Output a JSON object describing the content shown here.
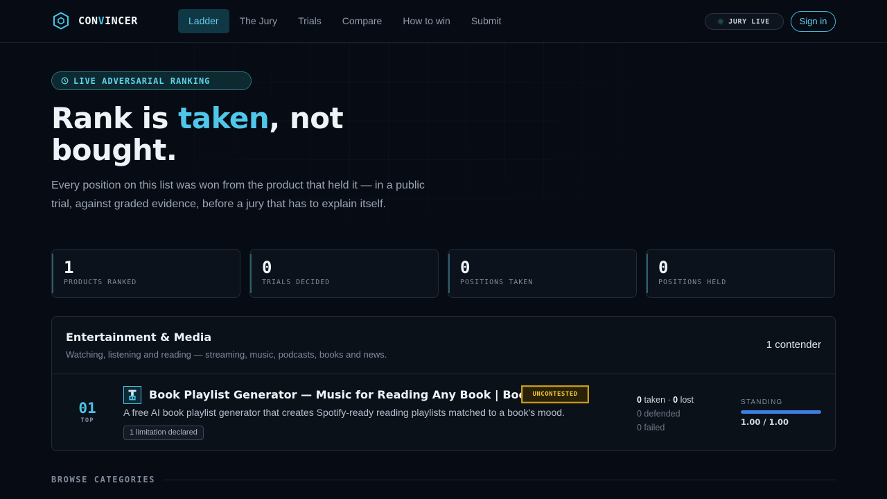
{
  "brand": {
    "name_a": "CON",
    "name_b": "V",
    "name_c": "INCER"
  },
  "nav": {
    "items": [
      {
        "label": "Ladder",
        "active": true
      },
      {
        "label": "The Jury",
        "active": false
      },
      {
        "label": "Trials",
        "active": false
      },
      {
        "label": "Compare",
        "active": false
      },
      {
        "label": "How to win",
        "active": false
      },
      {
        "label": "Submit",
        "active": false
      }
    ],
    "live_label": "JURY LIVE",
    "signin_label": "Sign in"
  },
  "hero": {
    "badge": "LIVE ADVERSARIAL RANKING",
    "title_a": "Rank is ",
    "title_hl": "taken",
    "title_b": ", not bought.",
    "subtitle": "Every position on this list was won from the product that held it — in a public trial, against graded evidence, before a jury that has to explain itself."
  },
  "stats": [
    {
      "value": "1",
      "label": "PRODUCTS RANKED"
    },
    {
      "value": "0",
      "label": "TRIALS DECIDED"
    },
    {
      "value": "0",
      "label": "POSITIONS TAKEN"
    },
    {
      "value": "0",
      "label": "POSITIONS HELD"
    }
  ],
  "category": {
    "title": "Entertainment & Media",
    "description": "Watching, listening and reading — streaming, music, podcasts, books and news.",
    "count": "1 contender",
    "entries": [
      {
        "rank": "01",
        "rank_tag": "TOP",
        "name": "Book Playlist Generator — Music for Reading Any Book | BookTuning",
        "badge": "UNCONTESTED",
        "description": "A free AI book playlist generator that creates Spotify-ready reading playlists matched to a book's mood.",
        "limitation": "1 limitation declared",
        "taken": "0",
        "taken_label": "taken",
        "lost": "0",
        "lost_label": "lost",
        "defended": "0 defended",
        "failed": "0 failed",
        "standing_label": "STANDING",
        "standing_value": "1.00 / 1.00",
        "standing_fraction": 1.0
      }
    ]
  },
  "browse": {
    "label": "BROWSE CATEGORIES"
  },
  "colors": {
    "accent": "#43c6ea",
    "badge_gold": "#f3c63a",
    "standing_bar": "#3d7fe0"
  }
}
